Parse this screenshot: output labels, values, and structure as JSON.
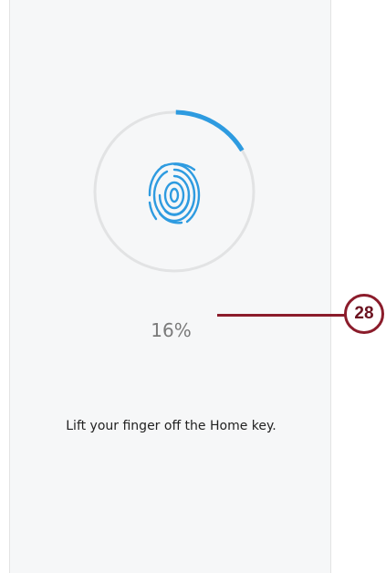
{
  "screen": {
    "progress": {
      "percent_label": "16%",
      "fraction": 0.16,
      "track_color": "#e2e3e4",
      "fill_color": "#2e9be0"
    },
    "fingerprint": {
      "icon": "fingerprint-icon",
      "color": "#2e9be0"
    },
    "instruction": "Lift your finger off the Home key."
  },
  "callout": {
    "number": "28",
    "color": "#8b1c2b"
  }
}
